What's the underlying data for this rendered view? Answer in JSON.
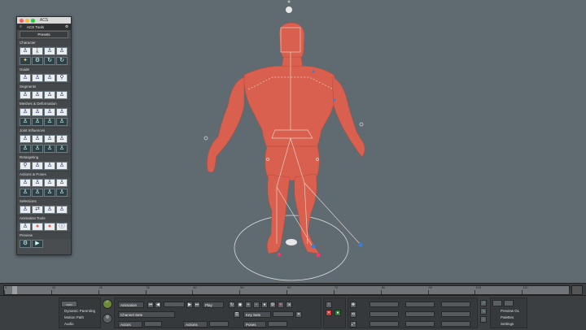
{
  "panel": {
    "window_title": "ACS",
    "tab_label": "ACS Tools",
    "presets_label": "Presets",
    "sections": [
      {
        "label": "Character",
        "rows": [
          [
            "figure-icon",
            "walk-icon",
            "figure-icon",
            "figure-icon"
          ],
          [
            "star-icon",
            "gear-icon",
            "refresh-icon",
            "refresh-icon"
          ]
        ]
      },
      {
        "label": "Guide",
        "rows": [
          [
            "figure-icon",
            "figure-icon",
            "figure-icon",
            "bike-icon"
          ]
        ]
      },
      {
        "label": "Segments",
        "rows": [
          [
            "figure-icon",
            "figure-icon",
            "figure-icon",
            "figure-icon"
          ]
        ]
      },
      {
        "label": "Meshes & Deformation",
        "rows": [
          [
            "figure-icon",
            "figure-icon",
            "figure-icon",
            "figure-icon"
          ],
          [
            "figure-icon",
            "figure-icon",
            "figure-icon",
            "figure-icon"
          ]
        ]
      },
      {
        "label": "Joint Influences",
        "rows": [
          [
            "figure-icon",
            "figure-icon",
            "figure-icon",
            "figure-icon"
          ],
          [
            "figure-icon",
            "figure-icon",
            "figure-icon",
            "figure-icon"
          ]
        ]
      },
      {
        "label": "Retargeting",
        "rows": [
          [
            "bike-icon",
            "figure-icon",
            "figure-icon",
            "figure-icon"
          ]
        ]
      },
      {
        "label": "Actions & Poses",
        "rows": [
          [
            "figure-icon",
            "figure-icon",
            "figure-icon",
            "figure-icon"
          ],
          [
            "figure-icon",
            "figure-icon",
            "figure-icon",
            "figure-icon"
          ]
        ]
      },
      {
        "label": "Selections",
        "rows": [
          [
            "figure-icon",
            "arrows-icon",
            "figure-icon",
            "figure-icon"
          ]
        ]
      },
      {
        "label": "Animation Tools",
        "rows": [
          [
            "figure-icon",
            "circle-icon",
            "circle-icon",
            "info-icon"
          ]
        ]
      },
      {
        "label": "Preview",
        "rows": [
          [
            "gear-icon",
            "play-icon"
          ]
        ]
      }
    ]
  },
  "timeline": {
    "ticks": [
      "0",
      "10",
      "20",
      "30",
      "40",
      "50",
      "60",
      "70",
      "80",
      "90",
      "100",
      "110",
      "120"
    ]
  },
  "bottom": {
    "modes": [
      "Dynamic Parenting",
      "Motion Path",
      "Audio"
    ],
    "animation_label": "Animation",
    "play_label": "Play",
    "channel_sets_label": "Channel Sets",
    "key_sets_label": "Key Sets",
    "actors_label": "Actors",
    "actions_label": "Actions",
    "poses_label": "Poses",
    "preview_gl_label": "Preview GL",
    "palettes_label": "Palettes",
    "settings_label": "Settings"
  },
  "colors": {
    "viewport_bg": "#5f6b71",
    "character": "#d9604f",
    "rig_lines": "#e6dccc",
    "handles": "#3d7bd8"
  }
}
